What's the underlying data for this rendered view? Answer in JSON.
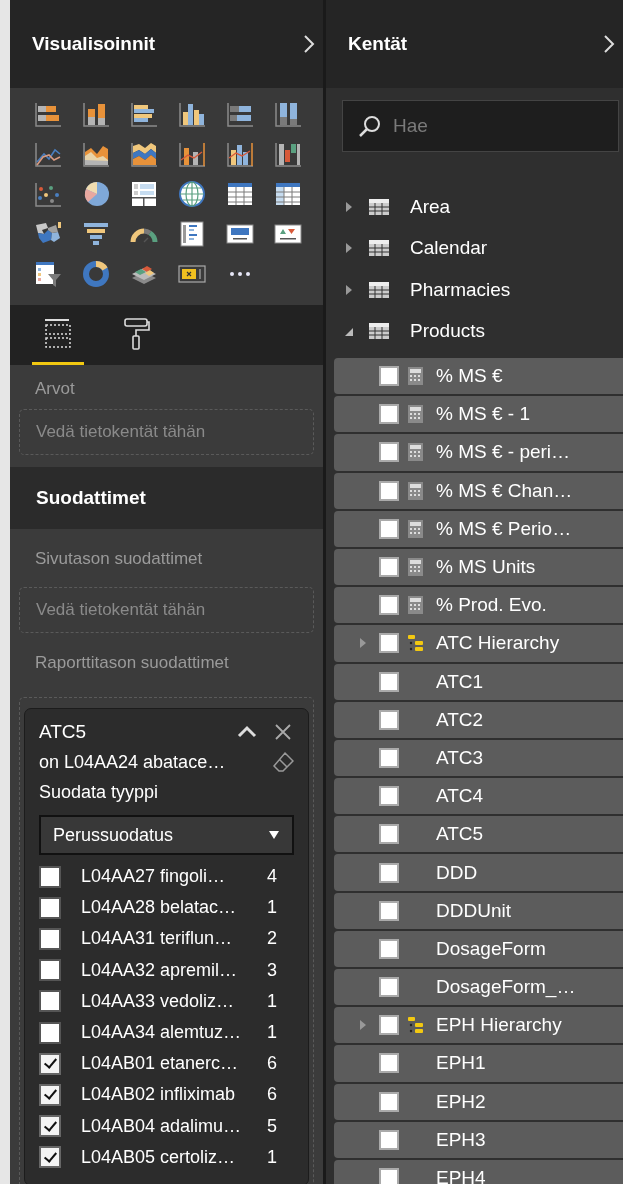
{
  "visualizations": {
    "title": "Visualisoinnit",
    "tabs": [
      {
        "selected": true
      },
      {
        "selected": false
      }
    ],
    "values_label": "Arvot",
    "values_drop_zone": "Vedä tietokentät tähän"
  },
  "filters": {
    "title": "Suodattimet",
    "page_label": "Sivutason suodattimet",
    "page_drop_zone": "Vedä tietokentät tähän",
    "report_label": "Raporttitason suodattimet",
    "card": {
      "title": "ATC5",
      "condition": "on L04AA24 abatace…",
      "type_label": "Suodata tyyppi",
      "type_value": "Perussuodatus",
      "items": [
        {
          "label": "L04AA27 fingoli…",
          "count": "4",
          "checked": false
        },
        {
          "label": "L04AA28 belatac…",
          "count": "1",
          "checked": false
        },
        {
          "label": "L04AA31 teriflun…",
          "count": "2",
          "checked": false
        },
        {
          "label": "L04AA32 apremil…",
          "count": "3",
          "checked": false
        },
        {
          "label": "L04AA33 vedoliz…",
          "count": "1",
          "checked": false
        },
        {
          "label": "L04AA34 alemtuz…",
          "count": "1",
          "checked": false
        },
        {
          "label": "L04AB01 etanerc…",
          "count": "6",
          "checked": true
        },
        {
          "label": "L04AB02 infliximab",
          "count": "6",
          "checked": true
        },
        {
          "label": "L04AB04 adalimu…",
          "count": "5",
          "checked": true
        },
        {
          "label": "L04AB05 certoliz…",
          "count": "1",
          "checked": true
        }
      ]
    }
  },
  "fields": {
    "title": "Kentät",
    "search": {
      "placeholder": "Hae"
    },
    "tables": [
      {
        "label": "Area",
        "expanded": false
      },
      {
        "label": "Calendar",
        "expanded": false
      },
      {
        "label": "Pharmacies",
        "expanded": false
      },
      {
        "label": "Products",
        "expanded": true,
        "children": [
          {
            "kind": "measure",
            "label": "% MS €",
            "checked": false
          },
          {
            "kind": "measure",
            "label": "% MS € - 1",
            "checked": false
          },
          {
            "kind": "measure",
            "label": "% MS € - peri…",
            "checked": false
          },
          {
            "kind": "measure",
            "label": "% MS € Chan…",
            "checked": false
          },
          {
            "kind": "measure",
            "label": "% MS € Perio…",
            "checked": false
          },
          {
            "kind": "measure",
            "label": "% MS Units",
            "checked": false
          },
          {
            "kind": "measure",
            "label": "% Prod. Evo.",
            "checked": false
          },
          {
            "kind": "hierarchy",
            "label": "ATC Hierarchy",
            "checked": false,
            "expanded": false
          },
          {
            "kind": "field",
            "label": "ATC1",
            "checked": false
          },
          {
            "kind": "field",
            "label": "ATC2",
            "checked": false
          },
          {
            "kind": "field",
            "label": "ATC3",
            "checked": false
          },
          {
            "kind": "field",
            "label": "ATC4",
            "checked": false
          },
          {
            "kind": "field",
            "label": "ATC5",
            "checked": false
          },
          {
            "kind": "field",
            "label": "DDD",
            "checked": false
          },
          {
            "kind": "field",
            "label": "DDDUnit",
            "checked": false
          },
          {
            "kind": "field",
            "label": "DosageForm",
            "checked": false
          },
          {
            "kind": "field",
            "label": "DosageForm_…",
            "checked": false
          },
          {
            "kind": "hierarchy",
            "label": "EPH Hierarchy",
            "checked": false,
            "expanded": false
          },
          {
            "kind": "field",
            "label": "EPH1",
            "checked": false
          },
          {
            "kind": "field",
            "label": "EPH2",
            "checked": false
          },
          {
            "kind": "field",
            "label": "EPH3",
            "checked": false
          },
          {
            "kind": "field",
            "label": "EPH4",
            "checked": false
          }
        ]
      }
    ]
  }
}
